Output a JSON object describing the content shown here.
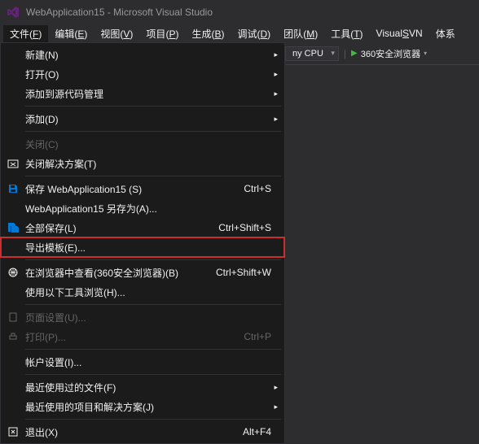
{
  "titlebar": {
    "title": "WebApplication15 - Microsoft Visual Studio"
  },
  "menubar": {
    "items": [
      {
        "label": "文件",
        "hotkey": "F",
        "active": true
      },
      {
        "label": "编辑",
        "hotkey": "E"
      },
      {
        "label": "视图",
        "hotkey": "V"
      },
      {
        "label": "项目",
        "hotkey": "P"
      },
      {
        "label": "生成",
        "hotkey": "B"
      },
      {
        "label": "调试",
        "hotkey": "D"
      },
      {
        "label": "团队",
        "hotkey": "M"
      },
      {
        "label": "工具",
        "hotkey": "T"
      },
      {
        "label": "VisualSVN",
        "hotkey": ""
      },
      {
        "label": "体系",
        "hotkey": ""
      }
    ]
  },
  "toolbar": {
    "cpu_selector": "ny CPU",
    "run_label": "360安全浏览器"
  },
  "file_menu": {
    "new": "新建(N)",
    "open": "打开(O)",
    "add_source": "添加到源代码管理",
    "add": "添加(D)",
    "close": "关闭(C)",
    "close_solution": "关闭解决方案(T)",
    "save": "保存 WebApplication15 (S)",
    "save_shortcut": "Ctrl+S",
    "save_as": "WebApplication15 另存为(A)...",
    "save_all": "全部保存(L)",
    "save_all_shortcut": "Ctrl+Shift+S",
    "export_template": "导出模板(E)...",
    "browse": "在浏览器中查看(360安全浏览器)(B)",
    "browse_shortcut": "Ctrl+Shift+W",
    "browse_with": "使用以下工具浏览(H)...",
    "page_setup": "页面设置(U)...",
    "print": "打印(P)...",
    "print_shortcut": "Ctrl+P",
    "account": "帐户设置(I)...",
    "recent_files": "最近使用过的文件(F)",
    "recent_projects": "最近使用的项目和解决方案(J)",
    "exit": "退出(X)",
    "exit_shortcut": "Alt+F4"
  }
}
